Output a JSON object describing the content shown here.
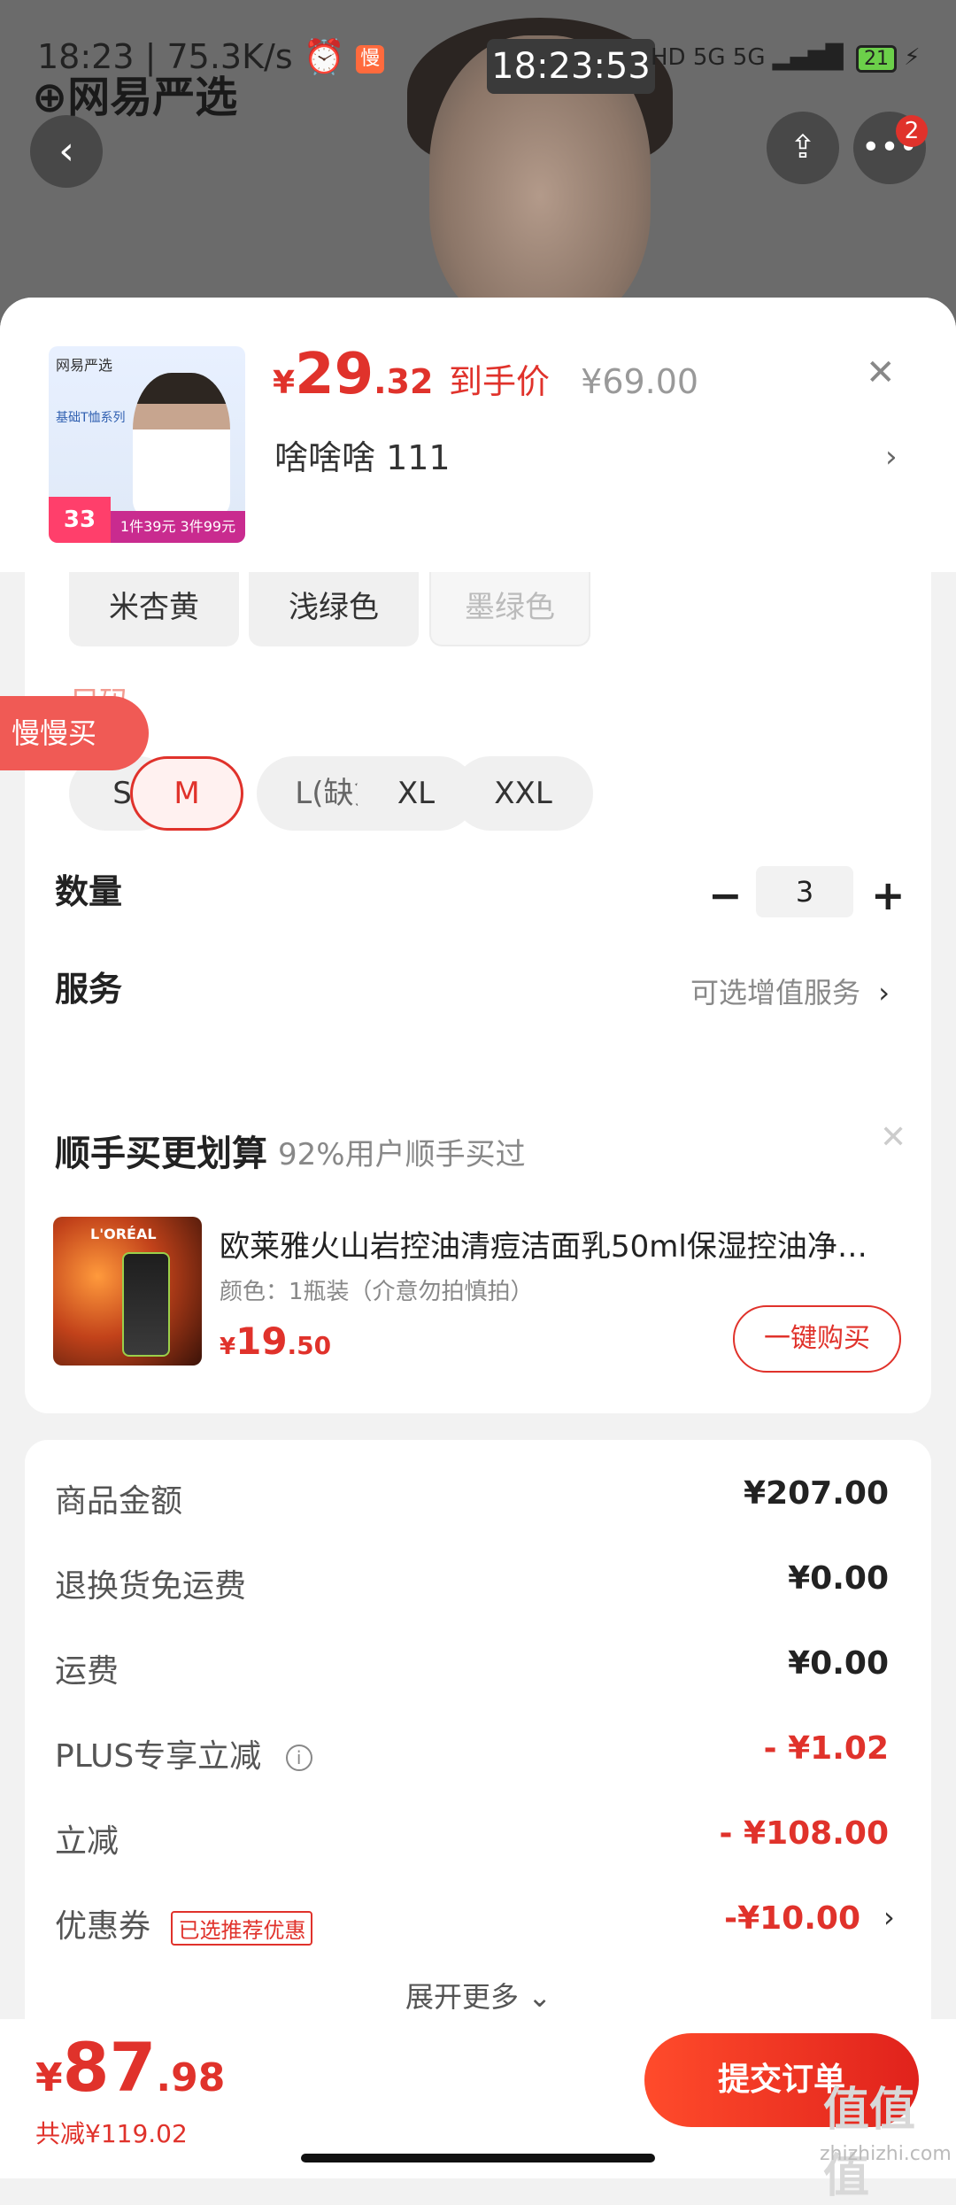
{
  "status": {
    "time_left": "18:23",
    "net_speed": "75.3K/s",
    "slow_badge": "慢",
    "clock": "18:23:53",
    "signal": "HD 5G 5G",
    "battery": "21"
  },
  "app": {
    "logo_text": "网易严选",
    "notification_count": "2"
  },
  "product": {
    "thumb_logo": "网易严选",
    "thumb_tag": "基础T恤系列",
    "thumb_price_tag": "33",
    "thumb_promo": "1件39元 3件99元",
    "price_yen": "¥",
    "price_int": "29",
    "price_dec": ".32",
    "price_label": "到手价",
    "orig_price": "¥69.00",
    "sku": "啥啥啥  111"
  },
  "colors": [
    "米杏黄",
    "浅绿色",
    "墨绿色"
  ],
  "size_section_label": "尺码",
  "slow_buy_label": "慢慢买",
  "sizes": [
    "S",
    "M",
    "L(缺货)",
    "XL",
    "XXL"
  ],
  "quantity": {
    "label": "数量",
    "value": "3",
    "minus": "−",
    "plus": "+"
  },
  "service": {
    "label": "服务",
    "value": "可选增值服务"
  },
  "recommend": {
    "title": "顺手买更划算",
    "subtitle": "92%用户顺手买过",
    "item_brand": "L'ORÉAL",
    "item_name": "欧莱雅火山岩控油清痘洁面乳50ml保湿控油净…",
    "item_spec": "颜色：1瓶装（介意勿拍慎拍）",
    "item_price_yen": "¥",
    "item_price_int": "19",
    "item_price_dec": ".50",
    "buy_label": "一键购买"
  },
  "summary": {
    "rows": [
      {
        "label": "商品金额",
        "value": "¥207.00"
      },
      {
        "label": "退换货免运费",
        "value": "¥0.00"
      },
      {
        "label": "运费",
        "value": "¥0.00"
      },
      {
        "label": "PLUS专享立减",
        "value": "- ¥1.02"
      },
      {
        "label": "立减",
        "value": "- ¥108.00"
      },
      {
        "label": "优惠券",
        "value": "-¥10.00"
      }
    ],
    "coupon_tag": "已选推荐优惠",
    "expand_label": "展开更多"
  },
  "footer": {
    "total_yen": "¥",
    "total_int": "87",
    "total_dec": ".98",
    "saved": "共减¥119.02",
    "submit_label": "提交订单",
    "watermark": "zhizhizhi.com",
    "watermark_mark": "值值值"
  },
  "colors_theme": {
    "accent": "#e0322b",
    "background": "#f2f2f2"
  }
}
